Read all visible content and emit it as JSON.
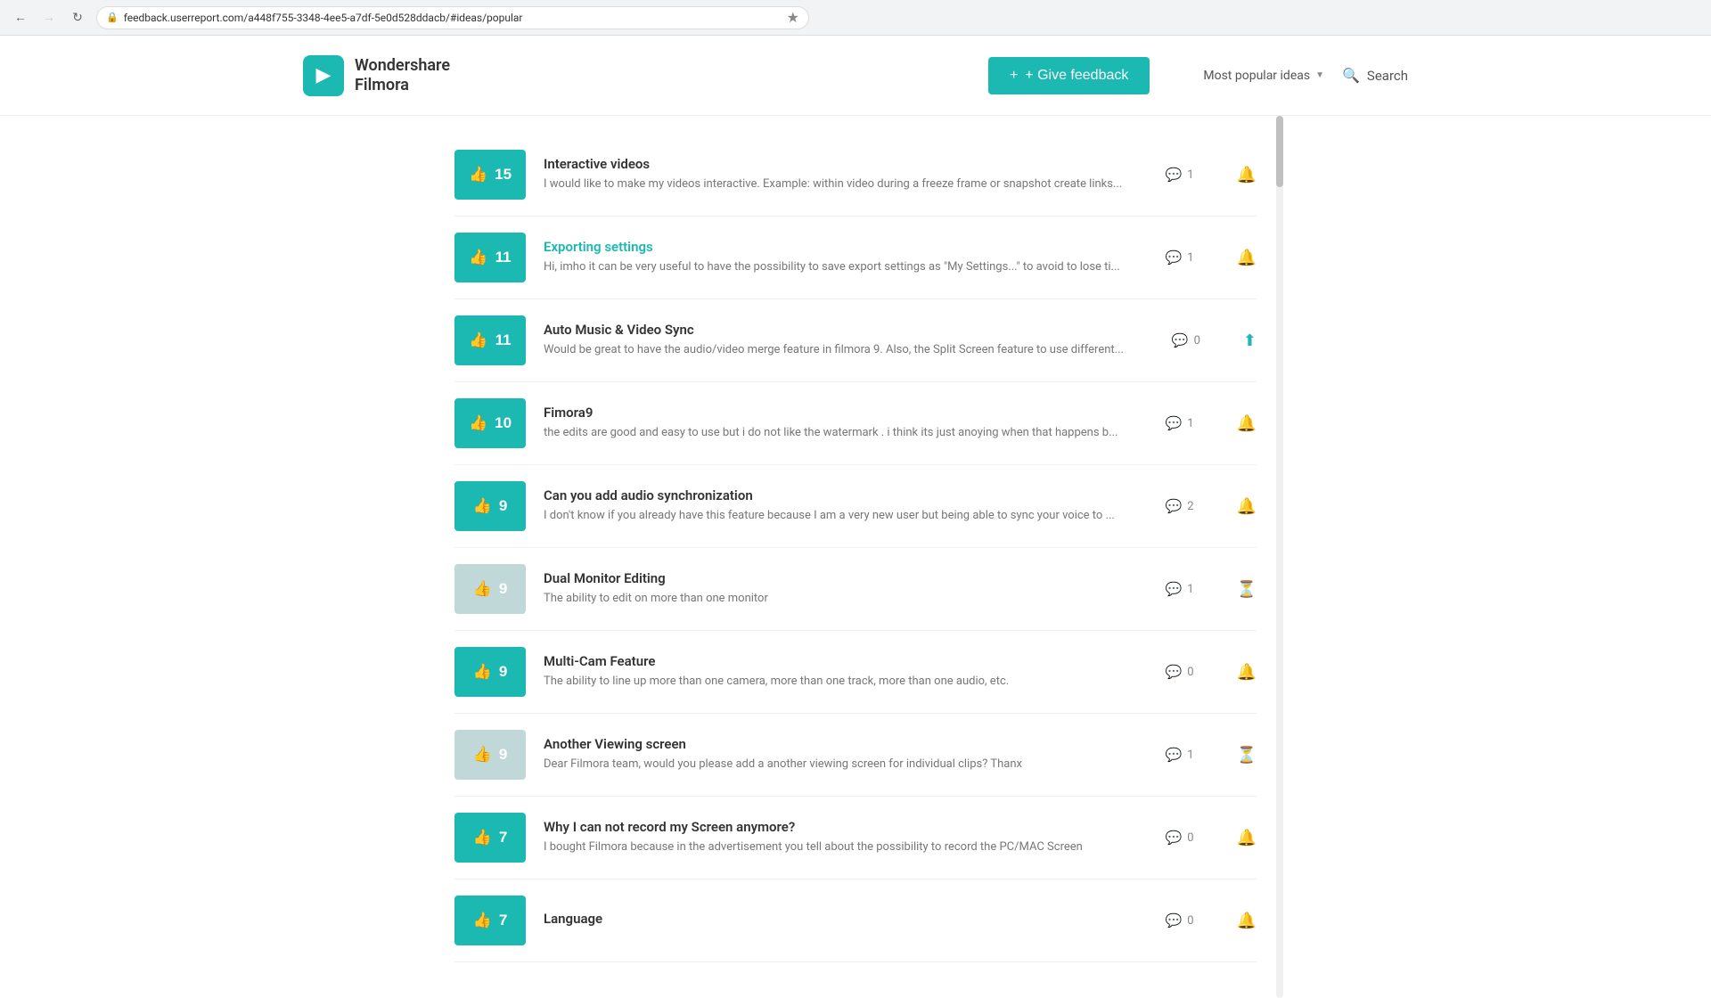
{
  "browser": {
    "url": "feedback.userreport.com/a448f755-3348-4ee5-a7df-5e0d528ddacb/#ideas/popular",
    "back_disabled": false,
    "forward_disabled": true
  },
  "header": {
    "logo_text_line1": "Wondershare",
    "logo_text_line2": "Filmora",
    "give_feedback_label": "+ Give feedback",
    "sort_label": "Most popular ideas",
    "search_label": "Search"
  },
  "ideas": [
    {
      "id": 1,
      "votes": 15,
      "vote_active": true,
      "title": "Interactive videos",
      "title_link": false,
      "description": "I would like to make my videos interactive. Example: within video during a freeze frame or snapshot create links...",
      "comments": 1,
      "notify_type": "bell"
    },
    {
      "id": 2,
      "votes": 11,
      "vote_active": true,
      "title": "Exporting settings",
      "title_link": true,
      "description": "Hi, imho it can be very useful to have the possibility to save export settings as \"My Settings...\" to avoid to lose ti...",
      "comments": 1,
      "notify_type": "bell"
    },
    {
      "id": 3,
      "votes": 11,
      "vote_active": true,
      "title": "Auto Music & Video Sync",
      "title_link": false,
      "description": "Would be great to have the audio/video merge feature in filmora 9. Also, the Split Screen feature to use different...",
      "comments": 0,
      "notify_type": "teal-arrow"
    },
    {
      "id": 4,
      "votes": 10,
      "vote_active": true,
      "title": "Fimora9",
      "title_link": false,
      "description": "the edits are good and easy to use but i do not like the watermark . i think its just anoying when that happens b...",
      "comments": 1,
      "notify_type": "bell"
    },
    {
      "id": 5,
      "votes": 9,
      "vote_active": true,
      "title": "Can you add audio synchronization",
      "title_link": false,
      "description": "I don't know if you already have this feature because I am a very new user but being able to sync your voice to ...",
      "comments": 2,
      "notify_type": "bell"
    },
    {
      "id": 6,
      "votes": 9,
      "vote_active": false,
      "title": "Dual Monitor Editing",
      "title_link": false,
      "description": "The ability to edit on more than one monitor",
      "comments": 1,
      "notify_type": "hourglass"
    },
    {
      "id": 7,
      "votes": 9,
      "vote_active": true,
      "title": "Multi-Cam Feature",
      "title_link": false,
      "description": "The ability to line up more than one camera, more than one track, more than one audio, etc.",
      "comments": 0,
      "notify_type": "bell"
    },
    {
      "id": 8,
      "votes": 9,
      "vote_active": false,
      "title": "Another Viewing screen",
      "title_link": false,
      "description": "Dear Filmora team, would you please add a another viewing screen for individual clips? Thanx",
      "comments": 1,
      "notify_type": "hourglass"
    },
    {
      "id": 9,
      "votes": 7,
      "vote_active": true,
      "title": "Why I can not record my Screen anymore?",
      "title_link": false,
      "description": "I bought Filmora because in the advertisement you tell about the possibility to record the PC/MAC Screen",
      "comments": 0,
      "notify_type": "bell"
    },
    {
      "id": 10,
      "votes": 7,
      "vote_active": true,
      "title": "Language",
      "title_link": false,
      "description": "",
      "comments": 0,
      "notify_type": "bell"
    }
  ]
}
